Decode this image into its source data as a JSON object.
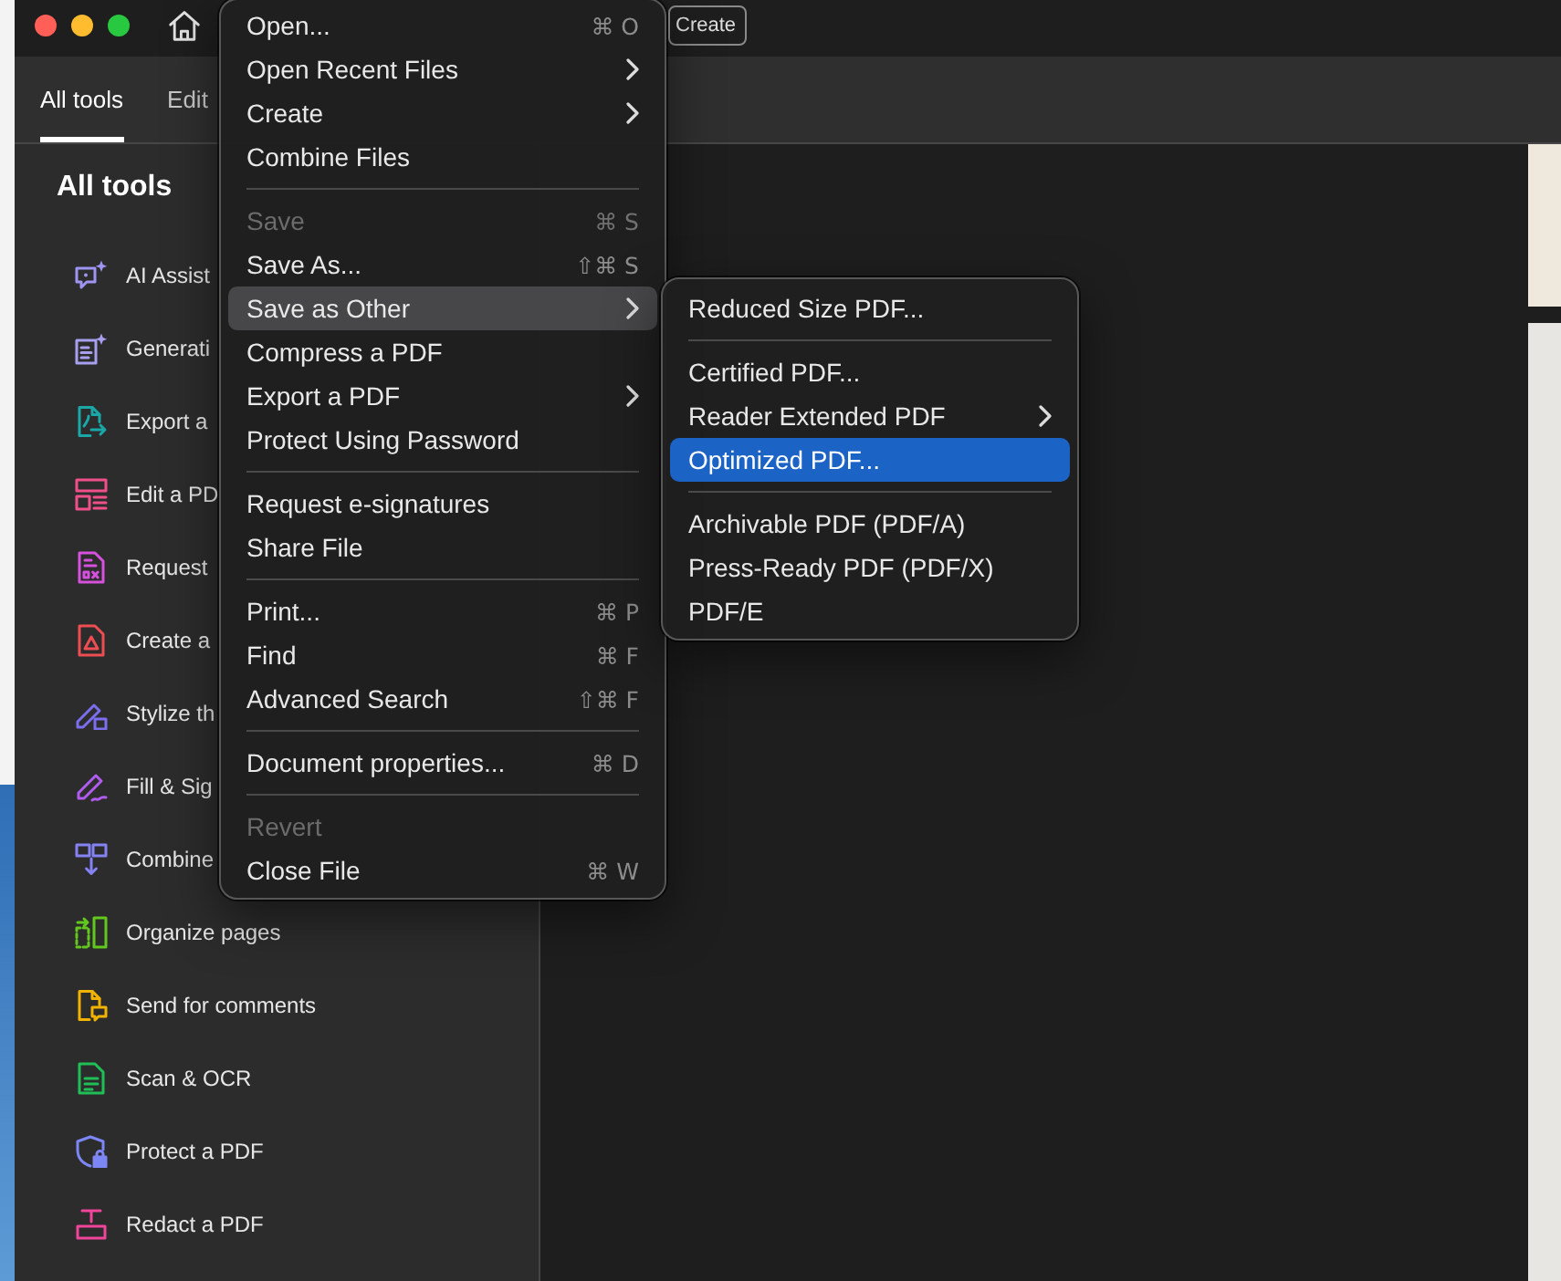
{
  "title_bar": {
    "create_button": "Create"
  },
  "tabs": [
    {
      "label": "All tools",
      "selected": true
    },
    {
      "label": "Edit",
      "selected": false
    }
  ],
  "sidebar": {
    "title": "All tools",
    "items": [
      {
        "label": "AI Assist",
        "color": "#9e94f2"
      },
      {
        "label": "Generati",
        "color": "#a7a0ef"
      },
      {
        "label": "Export a",
        "color": "#1aa7a7"
      },
      {
        "label": "Edit a PD",
        "color": "#f0508a"
      },
      {
        "label": "Request",
        "color": "#d651dc"
      },
      {
        "label": "Create a",
        "color": "#ee4d52"
      },
      {
        "label": "Stylize th",
        "color": "#7b6ff0"
      },
      {
        "label": "Fill & Sig",
        "color": "#b15cf0"
      },
      {
        "label": "Combine",
        "color": "#8582f3"
      },
      {
        "label": "Organize pages",
        "color": "#62c81e"
      },
      {
        "label": "Send for comments",
        "color": "#f2b300"
      },
      {
        "label": "Scan & OCR",
        "color": "#1fbf55"
      },
      {
        "label": "Protect a PDF",
        "color": "#7d86f5"
      },
      {
        "label": "Redact a PDF",
        "color": "#f0459a"
      }
    ]
  },
  "file_menu": {
    "groups": [
      {
        "items": [
          {
            "label": "Open...",
            "shortcut": "⌘ O",
            "has_submenu": false,
            "disabled": false,
            "expanded": false
          },
          {
            "label": "Open Recent Files",
            "has_submenu": true,
            "disabled": false,
            "expanded": false
          },
          {
            "label": "Create",
            "has_submenu": true,
            "disabled": false,
            "expanded": false
          },
          {
            "label": "Combine Files",
            "has_submenu": false,
            "disabled": false,
            "expanded": false
          }
        ]
      },
      {
        "items": [
          {
            "label": "Save",
            "shortcut": "⌘ S",
            "has_submenu": false,
            "disabled": true,
            "expanded": false
          },
          {
            "label": "Save As...",
            "shortcut": "⇧⌘ S",
            "has_submenu": false,
            "disabled": false,
            "expanded": false
          },
          {
            "label": "Save as Other",
            "has_submenu": true,
            "disabled": false,
            "expanded": true
          },
          {
            "label": "Compress a PDF",
            "has_submenu": false,
            "disabled": false,
            "expanded": false
          },
          {
            "label": "Export a PDF",
            "has_submenu": true,
            "disabled": false,
            "expanded": false
          },
          {
            "label": "Protect Using Password",
            "has_submenu": false,
            "disabled": false,
            "expanded": false
          }
        ]
      },
      {
        "items": [
          {
            "label": "Request e-signatures",
            "has_submenu": false,
            "disabled": false,
            "expanded": false
          },
          {
            "label": "Share File",
            "has_submenu": false,
            "disabled": false,
            "expanded": false
          }
        ]
      },
      {
        "items": [
          {
            "label": "Print...",
            "shortcut": "⌘ P",
            "has_submenu": false,
            "disabled": false,
            "expanded": false
          },
          {
            "label": "Find",
            "shortcut": "⌘ F",
            "has_submenu": false,
            "disabled": false,
            "expanded": false
          },
          {
            "label": "Advanced Search",
            "shortcut": "⇧⌘ F",
            "has_submenu": false,
            "disabled": false,
            "expanded": false
          }
        ]
      },
      {
        "items": [
          {
            "label": "Document properties...",
            "shortcut": "⌘ D",
            "has_submenu": false,
            "disabled": false,
            "expanded": false
          }
        ]
      },
      {
        "items": [
          {
            "label": "Revert",
            "has_submenu": false,
            "disabled": true,
            "expanded": false
          },
          {
            "label": "Close File",
            "shortcut": "⌘ W",
            "has_submenu": false,
            "disabled": false,
            "expanded": false
          }
        ]
      }
    ]
  },
  "submenu": {
    "groups": [
      {
        "items": [
          {
            "label": "Reduced Size PDF...",
            "has_submenu": false,
            "selected": false
          }
        ]
      },
      {
        "items": [
          {
            "label": "Certified PDF...",
            "has_submenu": false,
            "selected": false
          },
          {
            "label": "Reader Extended PDF",
            "has_submenu": true,
            "selected": false
          },
          {
            "label": "Optimized PDF...",
            "has_submenu": false,
            "selected": true
          }
        ]
      },
      {
        "items": [
          {
            "label": "Archivable PDF (PDF/A)",
            "has_submenu": false,
            "selected": false
          },
          {
            "label": "Press-Ready PDF (PDF/X)",
            "has_submenu": false,
            "selected": false
          },
          {
            "label": "PDF/E",
            "has_submenu": false,
            "selected": false
          }
        ]
      }
    ]
  }
}
